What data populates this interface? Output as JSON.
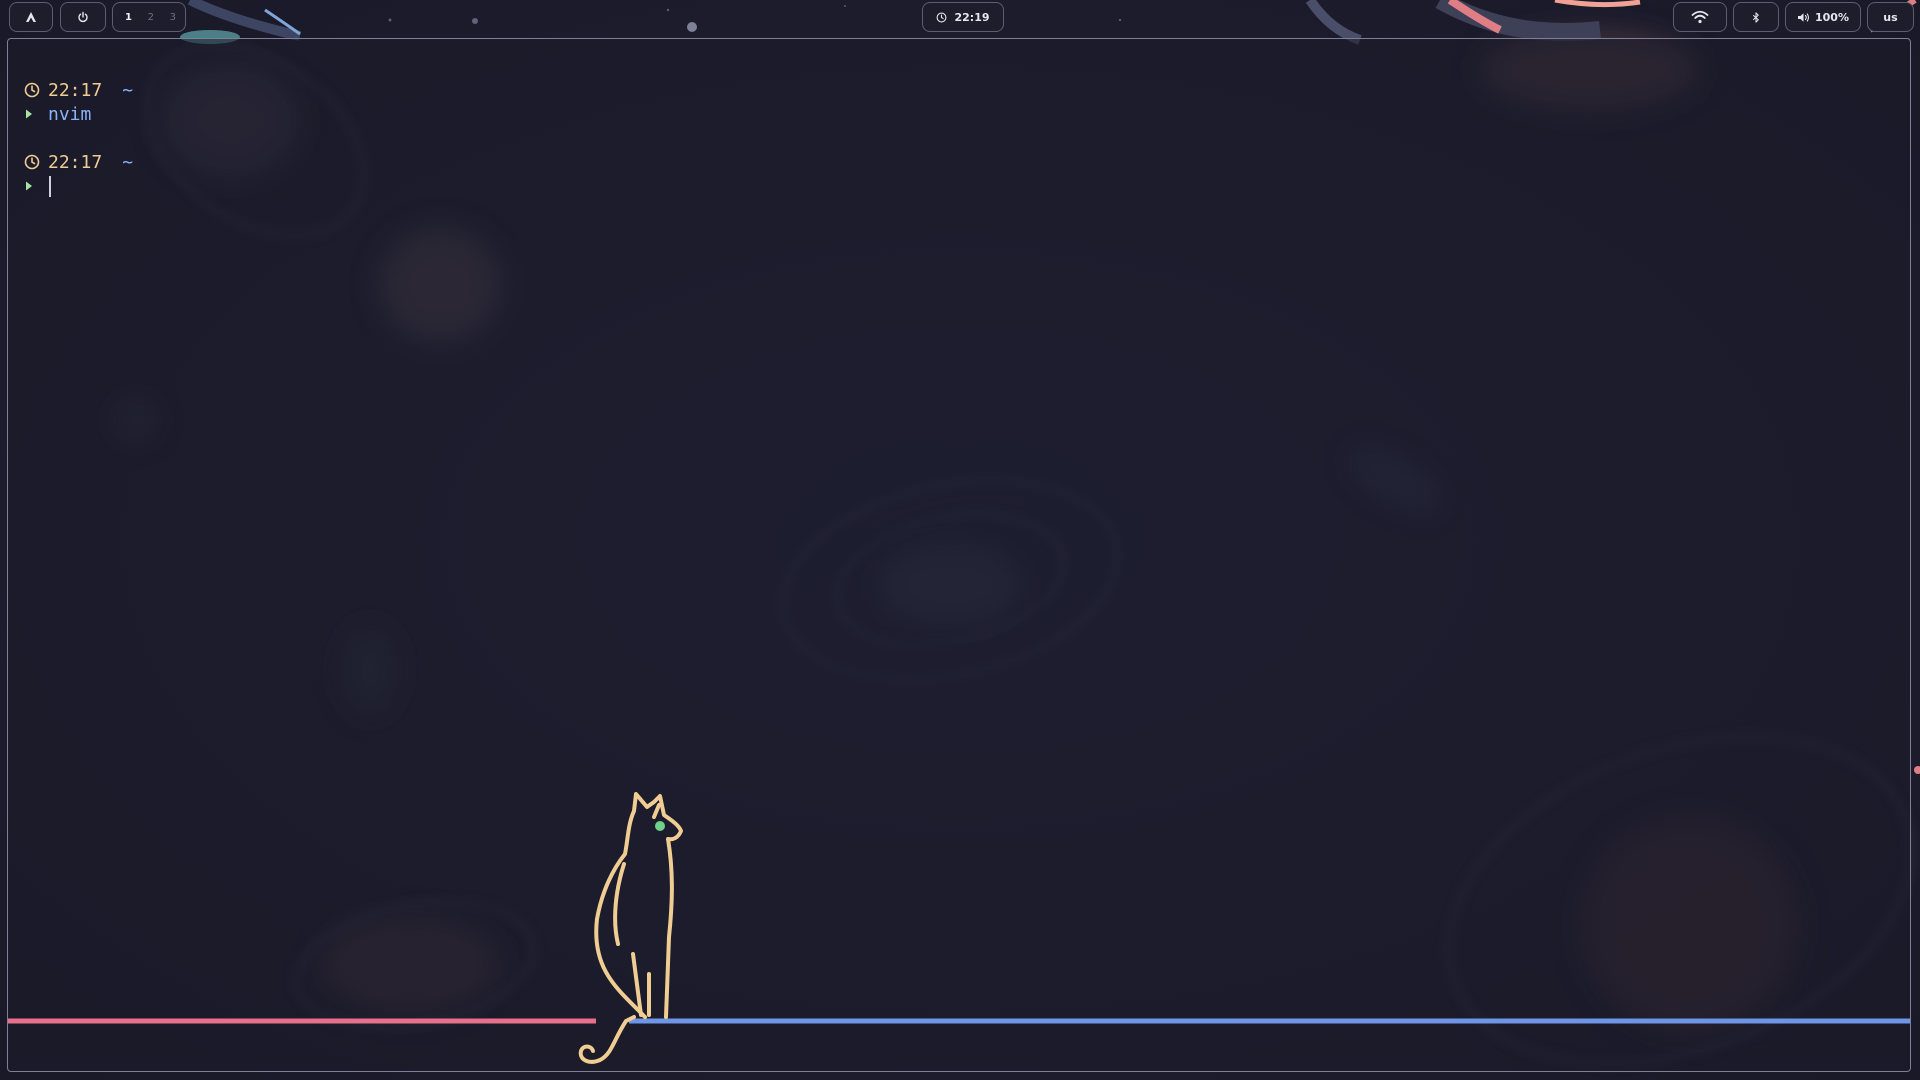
{
  "topbar": {
    "launcher_icon": "arch-icon",
    "power_icon": "power-icon",
    "workspaces": [
      {
        "label": "1",
        "active": true
      },
      {
        "label": "2",
        "active": false
      },
      {
        "label": "3",
        "active": false
      }
    ],
    "clock": {
      "icon": "clock-icon",
      "time": "22:19"
    },
    "wifi": {
      "icon": "wifi-icon"
    },
    "bluetooth": {
      "icon": "bluetooth-icon"
    },
    "volume": {
      "icon": "speaker-icon",
      "level": "100%"
    },
    "keyboard_layout": "us"
  },
  "terminal": {
    "history": [
      {
        "time": "22:17",
        "dir": "~",
        "command": "nvim"
      }
    ],
    "current": {
      "time": "22:17",
      "dir": "~",
      "command": ""
    }
  },
  "decor": {
    "cat_color": "#f0ce93",
    "cat_eye_color": "#6fd08c",
    "line_left_color": "#e8708a",
    "line_right_color": "#6f96e6"
  }
}
